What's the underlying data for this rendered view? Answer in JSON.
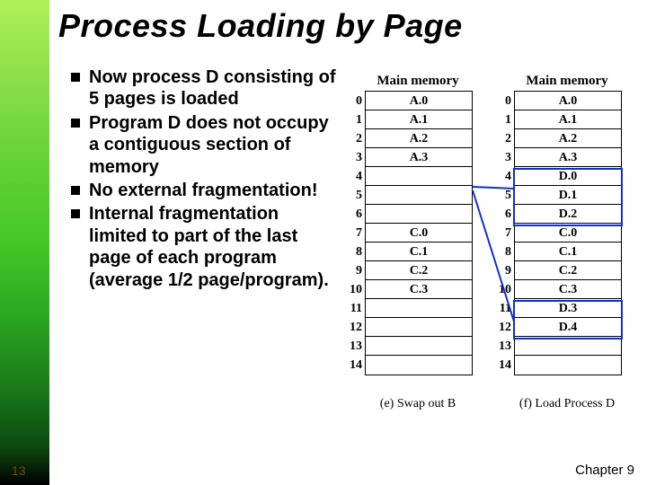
{
  "title": "Process Loading by Page",
  "bullets": [
    "Now process D consisting of 5 pages is loaded",
    "Program D does not occupy a contiguous section of memory",
    "No external fragmentation!",
    "Internal fragmentation limited to part of the last page of each program (average 1/2 page/program)."
  ],
  "memory_header": "Main memory",
  "left_frames": [
    "A.0",
    "A.1",
    "A.2",
    "A.3",
    "",
    "",
    "",
    "C.0",
    "C.1",
    "C.2",
    "C.3",
    "",
    "",
    "",
    ""
  ],
  "right_frames": [
    "A.0",
    "A.1",
    "A.2",
    "A.3",
    "D.0",
    "D.1",
    "D.2",
    "C.0",
    "C.1",
    "C.2",
    "C.3",
    "D.3",
    "D.4",
    "",
    ""
  ],
  "caption_left": "(e) Swap out B",
  "caption_right": "(f) Load Process D",
  "page_number": "13",
  "chapter": "Chapter 9"
}
